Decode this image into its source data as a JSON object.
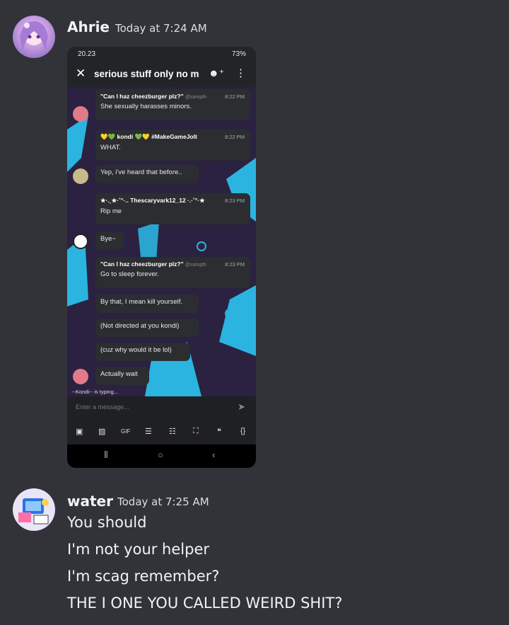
{
  "messages": [
    {
      "author": "Ahrie",
      "timestamp": "Today at 7:24 AM",
      "attachment": {
        "status_time": "20.23",
        "status_battery": "73%",
        "channel_name": "serious stuff only no m",
        "chat": [
          {
            "author": "\"Can I haz cheezburger plz?\"",
            "handle": "@sampth",
            "time": "8:22 PM",
            "text": "She sexually harasses minors."
          },
          {
            "author": "💛💚 kondi 💚💛 #MakeGameJolt",
            "handle": "",
            "time": "8:22 PM",
            "text": "WHAT."
          },
          {
            "author": "",
            "handle": "",
            "time": "",
            "text": "Yep, i've heard that before.."
          },
          {
            "author": "★·.¸★·˚°·.. Thescaryvark12_12 ·.·˚°·★",
            "handle": "",
            "time": "8:23 PM",
            "text": "Rip me"
          },
          {
            "author": "",
            "handle": "",
            "time": "",
            "text": "Bye~"
          },
          {
            "author": "\"Can I haz cheezburger plz?\"",
            "handle": "@sampth",
            "time": "8:23 PM",
            "text": "Go to sleep forever."
          },
          {
            "author": "",
            "handle": "",
            "time": "",
            "text": "By that, I mean kill yourself."
          },
          {
            "author": "",
            "handle": "",
            "time": "",
            "text": "(Not directed at you kondi)"
          },
          {
            "author": "",
            "handle": "",
            "time": "",
            "text": "(cuz why would it be lol)"
          },
          {
            "author": "",
            "handle": "",
            "time": "",
            "text": "Actually wait"
          }
        ],
        "typing": "--Kondi-- is typing...",
        "composer_placeholder": "Enter a message..."
      }
    },
    {
      "author": "water",
      "timestamp": "Today at 7:25 AM",
      "lines": [
        "You should",
        "I'm not your helper",
        "I'm scag remember?",
        "THE I ONE YOU CALLED WEIRD SHIT?"
      ]
    }
  ],
  "colors": {
    "background": "#313338",
    "username": "#f2f3f5",
    "chat_bg": "#2a2240",
    "accent_blue": "#2bb4e0"
  }
}
